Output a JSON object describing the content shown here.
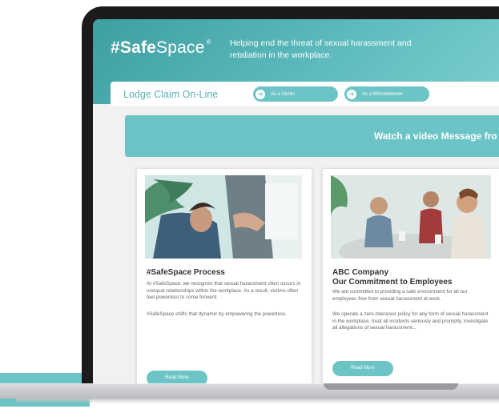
{
  "header": {
    "logo_bold": "#Safe",
    "logo_light": "Space",
    "logo_mark": "®",
    "tagline": "Helping end the threat of sexual harassment and retaliation in the workplace."
  },
  "claim": {
    "title": "Lodge Claim On-Line",
    "buttons": [
      {
        "label": "As a Victim",
        "icon": "arrow-circle-icon"
      },
      {
        "label": "As a Whistleblower",
        "icon": "arrow-circle-icon"
      }
    ]
  },
  "video": {
    "text": "Watch a video Message fro"
  },
  "cards": [
    {
      "title": "#SafeSpace Process",
      "subtitle": "",
      "paragraphs": [
        "At #SafeSpace, we recognize that sexual harassment often occurs in unequal relationships within the workplace. As a result, victims often feel powerless to come forward.",
        "#SafeSpace shifts that dynamic by empowering the powerless."
      ],
      "button": "Read More",
      "image": "office-meeting-photo"
    },
    {
      "title": "ABC Company",
      "subtitle": "Our Commitment to Employees",
      "paragraphs": [
        "We are committed to providing a safe environment for all our employees free from sexual harassment at work.",
        "We operate a zero-tolerance policy for any form of sexual harassment in the workplace, treat all incidents seriously and promptly, investigate all allegations of sexual harassment..."
      ],
      "button": "Read More",
      "image": "team-meeting-photo"
    }
  ],
  "colors": {
    "accent": "#6cc4c6",
    "header_dark": "#3e9ea2",
    "text_dark": "#333333"
  }
}
